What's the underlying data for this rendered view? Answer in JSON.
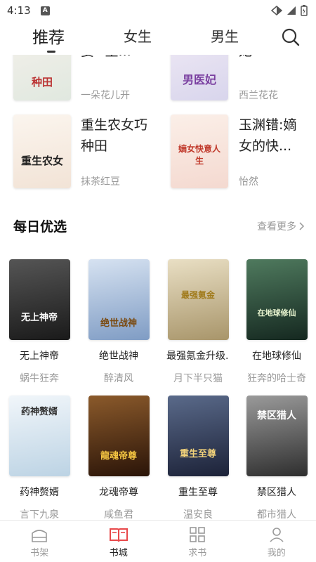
{
  "status": {
    "time": "4:13",
    "notif": "A"
  },
  "tabs": [
    {
      "label": "推荐",
      "active": true
    },
    {
      "label": "女生",
      "active": false
    },
    {
      "label": "男生",
      "active": false
    }
  ],
  "top_books": [
    {
      "title": "姜*·主...",
      "author": "一朵花儿开",
      "cover_text": "种田"
    },
    {
      "title": "妃",
      "author": "西兰花花",
      "cover_text": "男医妃"
    },
    {
      "title": "重生农女巧种田",
      "author": "抹茶红豆",
      "cover_text": "重生农女"
    },
    {
      "title": "玉渊错:嫡女的快...",
      "author": "怡然",
      "cover_text": "嫡女快意人生"
    }
  ],
  "section": {
    "title": "每日优选",
    "more": "查看更多"
  },
  "grid_books": [
    {
      "title": "无上神帝",
      "author": "蜗牛狂奔",
      "cover_text": "无上神帝",
      "color": "#3a3a3a"
    },
    {
      "title": "绝世战神",
      "author": "醉清风",
      "cover_text": "绝世战神",
      "color": "#8aa4c8"
    },
    {
      "title": "最强氪金升级...",
      "author": "月下半只猫",
      "cover_text": "最强氪金",
      "color": "#c9b98c"
    },
    {
      "title": "在地球修仙",
      "author": "狂奔的哈士奇",
      "cover_text": "在地球修仙",
      "color": "#2d4a3a"
    },
    {
      "title": "药神赘婿",
      "author": "言下九泉",
      "cover_text": "药神赘婿",
      "color": "#cfe0ec"
    },
    {
      "title": "龙魂帝尊",
      "author": "咸鱼君",
      "cover_text": "龍魂帝尊",
      "color": "#6b3a1e"
    },
    {
      "title": "重生至尊",
      "author": "温安良",
      "cover_text": "重生至尊",
      "color": "#2b3550"
    },
    {
      "title": "禁区猎人",
      "author": "都市猎人",
      "cover_text": "禁区猎人",
      "color": "#4a4a4a"
    }
  ],
  "nav": [
    {
      "label": "书架",
      "icon": "bookshelf-icon",
      "active": false
    },
    {
      "label": "书城",
      "icon": "book-open-icon",
      "active": true
    },
    {
      "label": "求书",
      "icon": "grid-icon",
      "active": false
    },
    {
      "label": "我的",
      "icon": "user-icon",
      "active": false
    }
  ],
  "colors": {
    "accent": "#e8484a",
    "muted": "#999999"
  }
}
